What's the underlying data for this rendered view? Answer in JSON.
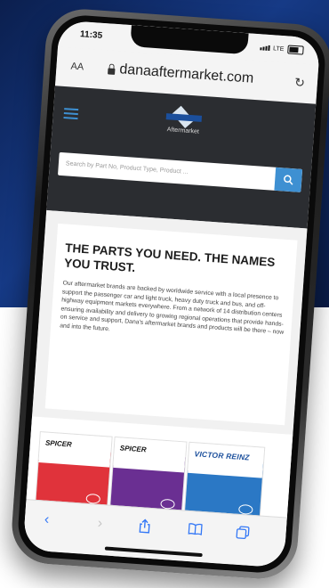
{
  "status_bar": {
    "time": "11:35",
    "network": "LTE"
  },
  "browser": {
    "text_size_label": "AA",
    "url": "danaaftermarket.com",
    "reload_icon": "reload-icon",
    "lock_icon": "lock-icon"
  },
  "site_header": {
    "logo_text": "Aftermarket",
    "search_placeholder": "Search by Part No, Product Type, Product ...",
    "menu_icon": "hamburger-menu-icon",
    "search_icon": "search-icon"
  },
  "hero": {
    "headline": "THE PARTS YOU NEED. THE NAMES YOU TRUST.",
    "body": "Our aftermarket brands are backed by worldwide service with a local presence to support the passenger car and light truck, heavy duty truck and bus, and off-highway equipment markets everywhere. From a network of 14 distribution centers ensuring availability and delivery to growing regional operations that provide hands-on service and support, Dana's aftermarket brands and products will be there – now and into the future."
  },
  "products": [
    {
      "brand": "SPICER",
      "color": "#e0333b"
    },
    {
      "brand": "SPICER",
      "color": "#6a2f92"
    },
    {
      "brand": "VICTOR REINZ",
      "color": "#2b78c5"
    }
  ],
  "toolbar": {
    "back_icon": "chevron-left-icon",
    "forward_icon": "chevron-right-icon",
    "share_icon": "share-icon",
    "bookmarks_icon": "book-icon",
    "tabs_icon": "tabs-icon"
  },
  "colors": {
    "accent": "#3e90d2",
    "header_bg": "#2b2d31",
    "ios_blue": "#3478f6"
  }
}
